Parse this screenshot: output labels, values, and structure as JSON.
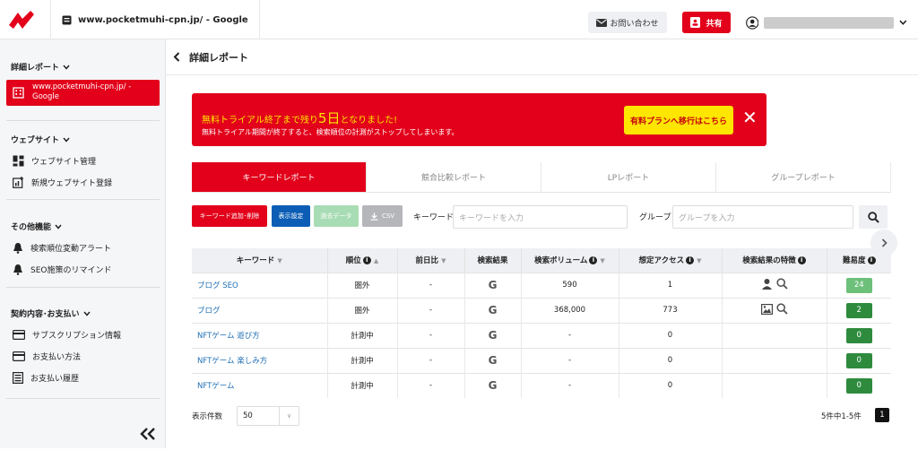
{
  "topbar": {
    "site_title": "www.pocketmuhi-cpn.jp/ - Google",
    "contact_label": "お問い合わせ",
    "share_label": "共有"
  },
  "sidebar": {
    "report_section": "詳細レポート",
    "active_site": "www.pocketmuhi-cpn.jp/ - Google",
    "website_section": "ウェブサイト",
    "website_items": [
      "ウェブサイト管理",
      "新規ウェブサイト登録"
    ],
    "other_section": "その他機能",
    "other_items": [
      "検索順位変動アラート",
      "SEO施策のリマインド"
    ],
    "contract_section": "契約内容･お支払い",
    "contract_items": [
      "サブスクリプション情報",
      "お支払い方法",
      "お支払い履歴"
    ]
  },
  "page": {
    "title": "詳細レポート"
  },
  "banner": {
    "line1_pre": "無料トライアル終了まで残り",
    "line1_days": "5日",
    "line1_post": "となりました!",
    "line2": "無料トライアル期間が終了すると、検索順位の計測がストップしてしまいます。",
    "upgrade_label": "有料プランへ移行はこちら",
    "close_label": "✕"
  },
  "tabs": [
    "キーワードレポート",
    "競合比較レポート",
    "LPレポート",
    "グループレポート"
  ],
  "toolbar": {
    "add_delete": "キーワード追加･削除",
    "display_settings": "表示設定",
    "past_data": "過去データ",
    "csv": "CSV",
    "keyword_label": "キーワード",
    "keyword_placeholder": "キーワードを入力",
    "group_label": "グループ",
    "group_placeholder": "グループを入力"
  },
  "table": {
    "headers": [
      "キーワード",
      "順位",
      "前日比",
      "検索結果",
      "検索ボリューム",
      "想定アクセス",
      "検索結果の特徴",
      "難易度"
    ],
    "rows": [
      {
        "keyword": "ブログ SEO",
        "rank": "圏外",
        "diff": "-",
        "result": "G",
        "volume": "590",
        "access": "1",
        "feature": "person",
        "difficulty": "24",
        "diff_color": "#6dc07a"
      },
      {
        "keyword": "ブログ",
        "rank": "圏外",
        "diff": "-",
        "result": "G",
        "volume": "368,000",
        "access": "773",
        "feature": "image",
        "difficulty": "2",
        "diff_color": "#2e8b3e"
      },
      {
        "keyword": "NFTゲーム 遊び方",
        "rank": "計測中",
        "diff": "-",
        "result": "G",
        "volume": "-",
        "access": "0",
        "feature": "",
        "difficulty": "0",
        "diff_color": "#2e8b3e"
      },
      {
        "keyword": "NFTゲーム 楽しみ方",
        "rank": "計測中",
        "diff": "-",
        "result": "G",
        "volume": "-",
        "access": "0",
        "feature": "",
        "difficulty": "0",
        "diff_color": "#2e8b3e"
      },
      {
        "keyword": "NFTゲーム",
        "rank": "計測中",
        "diff": "-",
        "result": "G",
        "volume": "-",
        "access": "0",
        "feature": "",
        "difficulty": "0",
        "diff_color": "#2e8b3e"
      }
    ]
  },
  "footer": {
    "per_page_label": "表示件数",
    "per_page_value": "50",
    "count_text": "5件中1-5件",
    "page_number": "1"
  },
  "colors": {
    "accent": "#e2001a",
    "blue": "#0b5db5",
    "yellow": "#ffe600"
  }
}
